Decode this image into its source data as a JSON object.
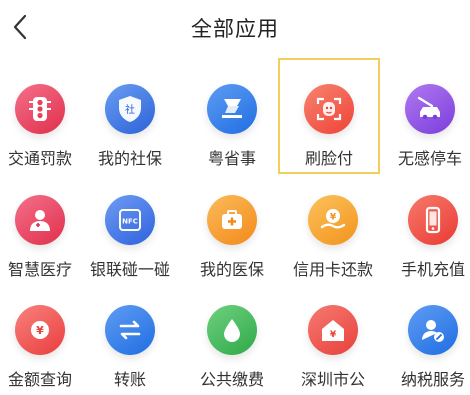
{
  "header": {
    "title": "全部应用"
  },
  "apps": [
    {
      "label": "交通罚款",
      "icon": "traffic-light-icon",
      "color": "#e9405a"
    },
    {
      "label": "我的社保",
      "icon": "social-security-shield-icon",
      "color": "#3a73e0"
    },
    {
      "label": "粤省事",
      "icon": "yue-sheng-shi-icon",
      "color": "#2f7ee8"
    },
    {
      "label": "刷脸付",
      "icon": "face-pay-icon",
      "color": "#f25a4a"
    },
    {
      "label": "无感停车",
      "icon": "parking-car-icon",
      "color": "#8d4fe0"
    },
    {
      "label": "智慧医疗",
      "icon": "doctor-icon",
      "color": "#e9405a"
    },
    {
      "label": "银联碰一碰",
      "icon": "nfc-icon",
      "color": "#3e6fe4"
    },
    {
      "label": "我的医保",
      "icon": "medical-kit-icon",
      "color": "#f59b2b"
    },
    {
      "label": "信用卡还款",
      "icon": "credit-card-repay-icon",
      "color": "#f3a02a"
    },
    {
      "label": "手机充值",
      "icon": "phone-recharge-icon",
      "color": "#f0453f"
    },
    {
      "label": "金额查询",
      "icon": "yuan-coin-icon",
      "color": "#f04a4a"
    },
    {
      "label": "转账",
      "icon": "transfer-arrows-icon",
      "color": "#2f7ee8"
    },
    {
      "label": "公共缴费",
      "icon": "water-drop-icon",
      "color": "#3fb955"
    },
    {
      "label": "深圳市公",
      "icon": "housing-fund-icon",
      "color": "#ee4b44"
    },
    {
      "label": "纳税服务",
      "icon": "tax-user-icon",
      "color": "#2f7ee8"
    }
  ],
  "selected_label": "刷脸付"
}
